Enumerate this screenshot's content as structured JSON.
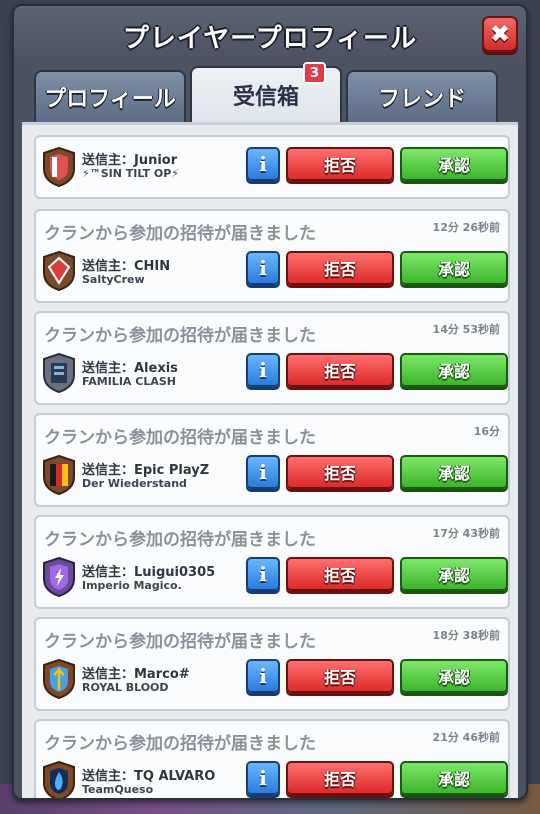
{
  "window": {
    "title": "プレイヤープロフィール",
    "close_label": "✖"
  },
  "tabs": [
    {
      "label": "プロフィール",
      "active": false
    },
    {
      "label": "受信箱",
      "active": true,
      "badge": "3"
    },
    {
      "label": "フレンド",
      "active": false
    }
  ],
  "buttons": {
    "info_label": "i",
    "reject_label": "拒否",
    "accept_label": "承認"
  },
  "invites": [
    {
      "message": "",
      "time": "",
      "sender": "送信主：Junior",
      "clan": "⚡™SIN TILT OP⚡",
      "crest_color": "#d23a3a"
    },
    {
      "message": "クランから参加の招待が届きました",
      "time": "12分 26秒前",
      "sender": "送信主：CHIN",
      "clan": "SaltyCrew",
      "crest_color": "#c83a3a"
    },
    {
      "message": "クランから参加の招待が届きました",
      "time": "14分 53秒前",
      "sender": "送信主：Alexis",
      "clan": "FAMILIA CLASH",
      "crest_color": "#3a5a8a"
    },
    {
      "message": "クランから参加の招待が届きました",
      "time": "16分",
      "sender": "送信主：Epic PlayZ",
      "clan": "Der Wiederstand",
      "crest_color": "#d8b02a"
    },
    {
      "message": "クランから参加の招待が届きました",
      "time": "17分 43秒前",
      "sender": "送信主：Luigui0305",
      "clan": "Imperio Magico.",
      "crest_color": "#8a4ad0"
    },
    {
      "message": "クランから参加の招待が届きました",
      "time": "18分 38秒前",
      "sender": "送信主：Marco#",
      "clan": "ROYAL BLOOD",
      "crest_color": "#3a8ad0"
    },
    {
      "message": "クランから参加の招待が届きました",
      "time": "21分 46秒前",
      "sender": "送信主：TQ ALVARO",
      "clan": "TeamQueso",
      "crest_color": "#2a6ad0"
    }
  ]
}
